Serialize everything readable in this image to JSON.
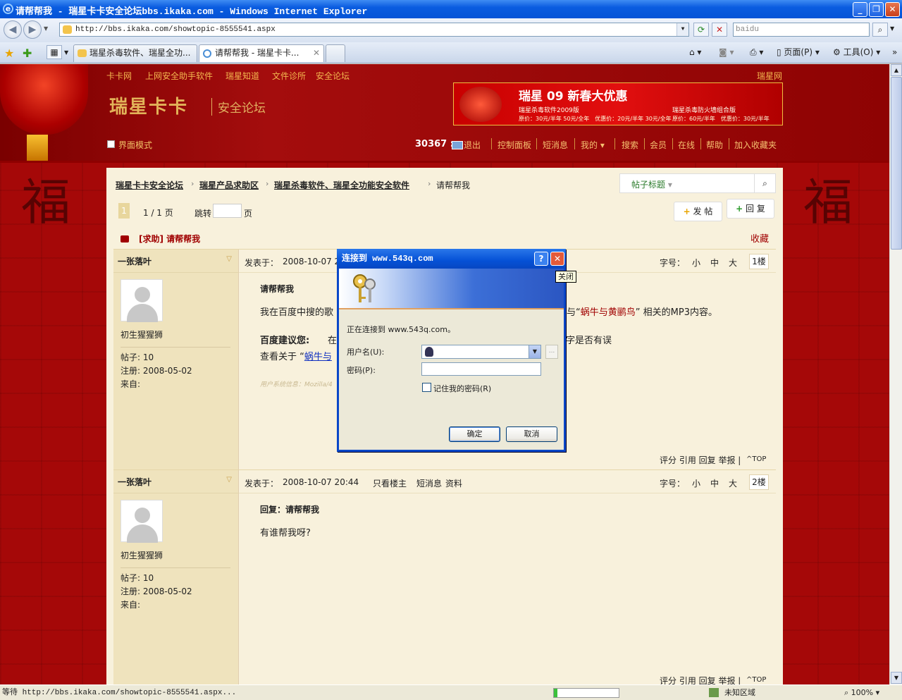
{
  "window": {
    "title": "请帮帮我 - 瑞星卡卡安全论坛bbs.ikaka.com - Windows Internet Explorer"
  },
  "address": {
    "url": "http://bbs.ikaka.com/showtopic-8555541.aspx",
    "search_placeholder": "baidu"
  },
  "tabs": [
    {
      "label": "瑞星杀毒软件、瑞星全功..."
    },
    {
      "label": "请帮帮我 - 瑞星卡卡..."
    }
  ],
  "toolbar": {
    "page": "页面(P)",
    "tools": "工具(O)"
  },
  "site": {
    "top_links": [
      "卡卡网",
      "上网安全助手软件",
      "瑞星知道",
      "文件诊所",
      "安全论坛"
    ],
    "top_right": "瑞星网",
    "logo": "瑞星卡卡",
    "logo_sub": "安全论坛",
    "banner": {
      "headline": "瑞星 09 新春大优惠",
      "left_title": "瑞星杀毒软件2009版",
      "right_title": "瑞星杀毒防火墙组合版",
      "left_price": "原价：30元/半年 50元/全年　优惠价：20元/半年 30元/全年",
      "right_price": "原价：60元/半年　优惠价：30元/半年"
    },
    "mode_label": "界面模式",
    "user": "30367 :",
    "nav": [
      "退出",
      "控制面板",
      "短消息",
      "我的",
      "搜索",
      "会员",
      "在线",
      "帮助",
      "加入收藏夹"
    ]
  },
  "breadcrumb": [
    "瑞星卡卡安全论坛",
    "瑞星产品求助区",
    "瑞星杀毒软件、瑞星全功能安全软件",
    "请帮帮我"
  ],
  "search": {
    "scope": "帖子标题"
  },
  "pager": {
    "current": "1",
    "total": "1 / 1 页",
    "jump": "跳转",
    "page_suffix": "页"
  },
  "actions": {
    "new_post": "发 帖",
    "reply": "回 复"
  },
  "topic": {
    "title": "[求助] 请帮帮我",
    "favorite": "收藏"
  },
  "posts": [
    {
      "author": "一张落叶",
      "rank": "初生猩猩狮",
      "posts": "帖子: 10",
      "registered": "注册: 2008-05-02",
      "from": "来自:",
      "posted_label": "发表于：",
      "posted_at": "2008-10-07 2",
      "font_label": "字号：",
      "sizes": [
        "小",
        "中",
        "大"
      ],
      "floor": "1楼",
      "subject": "请帮帮我",
      "body_a": "我在百度中搜的歌",
      "body_b": "到与“",
      "song": "蜗牛与黄鹂鸟",
      "body_c": "” 相关的MP3内容。",
      "suggest_label": "百度建议您:",
      "suggest_a": "在",
      "suggest_b": "字是否有误",
      "view_about": "查看关于 “",
      "view_link": "蜗牛与",
      "sysinfo": "用户系统信息：Mozilla/4",
      "footer": "评分 引用 回复 举报 |",
      "top": "TOP"
    },
    {
      "author": "一张落叶",
      "rank": "初生猩猩狮",
      "posts": "帖子: 10",
      "registered": "注册: 2008-05-02",
      "from": "来自:",
      "posted_label": "发表于：",
      "posted_at": "2008-10-07 20:44",
      "only_host": "只看楼主",
      "msg": "短消息",
      "profile": "资料",
      "font_label": "字号：",
      "sizes": [
        "小",
        "中",
        "大"
      ],
      "floor": "2楼",
      "subject": "回复：请帮帮我",
      "body": "有谁帮我呀?",
      "footer": "评分 引用 回复 举报 |",
      "top": "TOP"
    }
  ],
  "dialog": {
    "title": "连接到 www.543q.com",
    "connecting": "正在连接到 www.543q.com。",
    "username_label": "用户名(U):",
    "password_label": "密码(P):",
    "remember": "记住我的密码(R)",
    "ok": "确定",
    "cancel": "取消",
    "tooltip": "关闭"
  },
  "status": {
    "text": "等待 http://bbs.ikaka.com/showtopic-8555541.aspx...",
    "zone": "未知区域",
    "zoom": "100%"
  },
  "background_glyphs": [
    "福",
    "福"
  ]
}
